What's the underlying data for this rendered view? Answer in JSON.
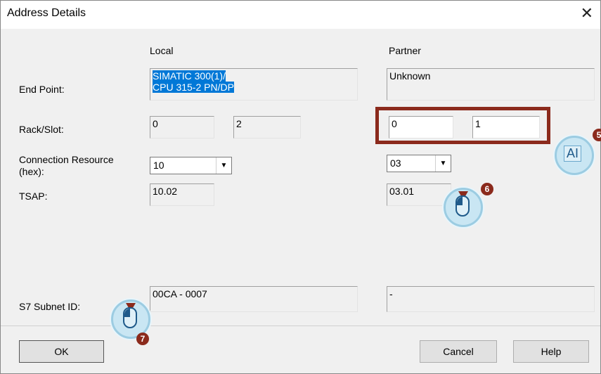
{
  "dialog": {
    "title": "Address Details",
    "close_glyph": "✕"
  },
  "columns": {
    "local": "Local",
    "partner": "Partner"
  },
  "labels": {
    "end_point": "End Point:",
    "rack_slot": "Rack/Slot:",
    "conn_resource_1": "Connection Resource",
    "conn_resource_2": "(hex):",
    "tsap": "TSAP:",
    "subnet": "S7 Subnet ID:"
  },
  "local": {
    "end_point_line1": "SIMATIC 300(1)/",
    "end_point_line2": "CPU 315-2 PN/DP",
    "rack": "0",
    "slot": "2",
    "conn_resource": "10",
    "tsap": "10.02",
    "subnet": "00CA - 0007"
  },
  "partner": {
    "end_point": "Unknown",
    "rack": "0",
    "slot": "1",
    "conn_resource": "03",
    "tsap": "03.01",
    "subnet": "-"
  },
  "buttons": {
    "ok": "OK",
    "cancel": "Cancel",
    "help": "Help"
  },
  "callouts": [
    {
      "number": "5",
      "icon": "text-cursor-icon",
      "text": "AI"
    },
    {
      "number": "6",
      "icon": "mouse-left-click-icon"
    },
    {
      "number": "7",
      "icon": "mouse-left-click-icon"
    }
  ],
  "colors": {
    "highlight_frame": "#8b2a1c",
    "selection": "#0078d7",
    "callout_fill": "#c9e6f3"
  }
}
